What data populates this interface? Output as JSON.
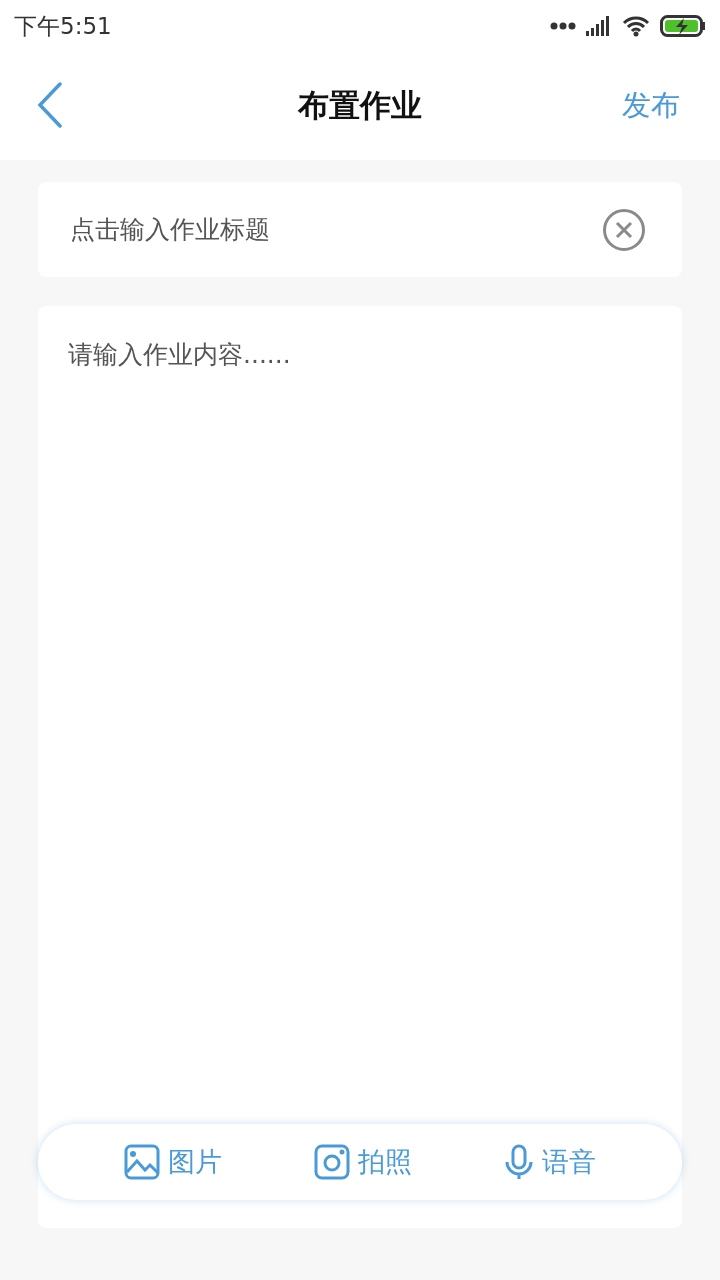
{
  "status_bar": {
    "time": "下午5:51"
  },
  "nav": {
    "title": "布置作业",
    "action": "发布"
  },
  "title_field": {
    "placeholder": "点击输入作业标题"
  },
  "content_field": {
    "placeholder": "请输入作业内容......"
  },
  "toolbar": [
    {
      "kind": "image",
      "label": "图片"
    },
    {
      "kind": "camera",
      "label": "拍照"
    },
    {
      "kind": "voice",
      "label": "语音"
    }
  ]
}
